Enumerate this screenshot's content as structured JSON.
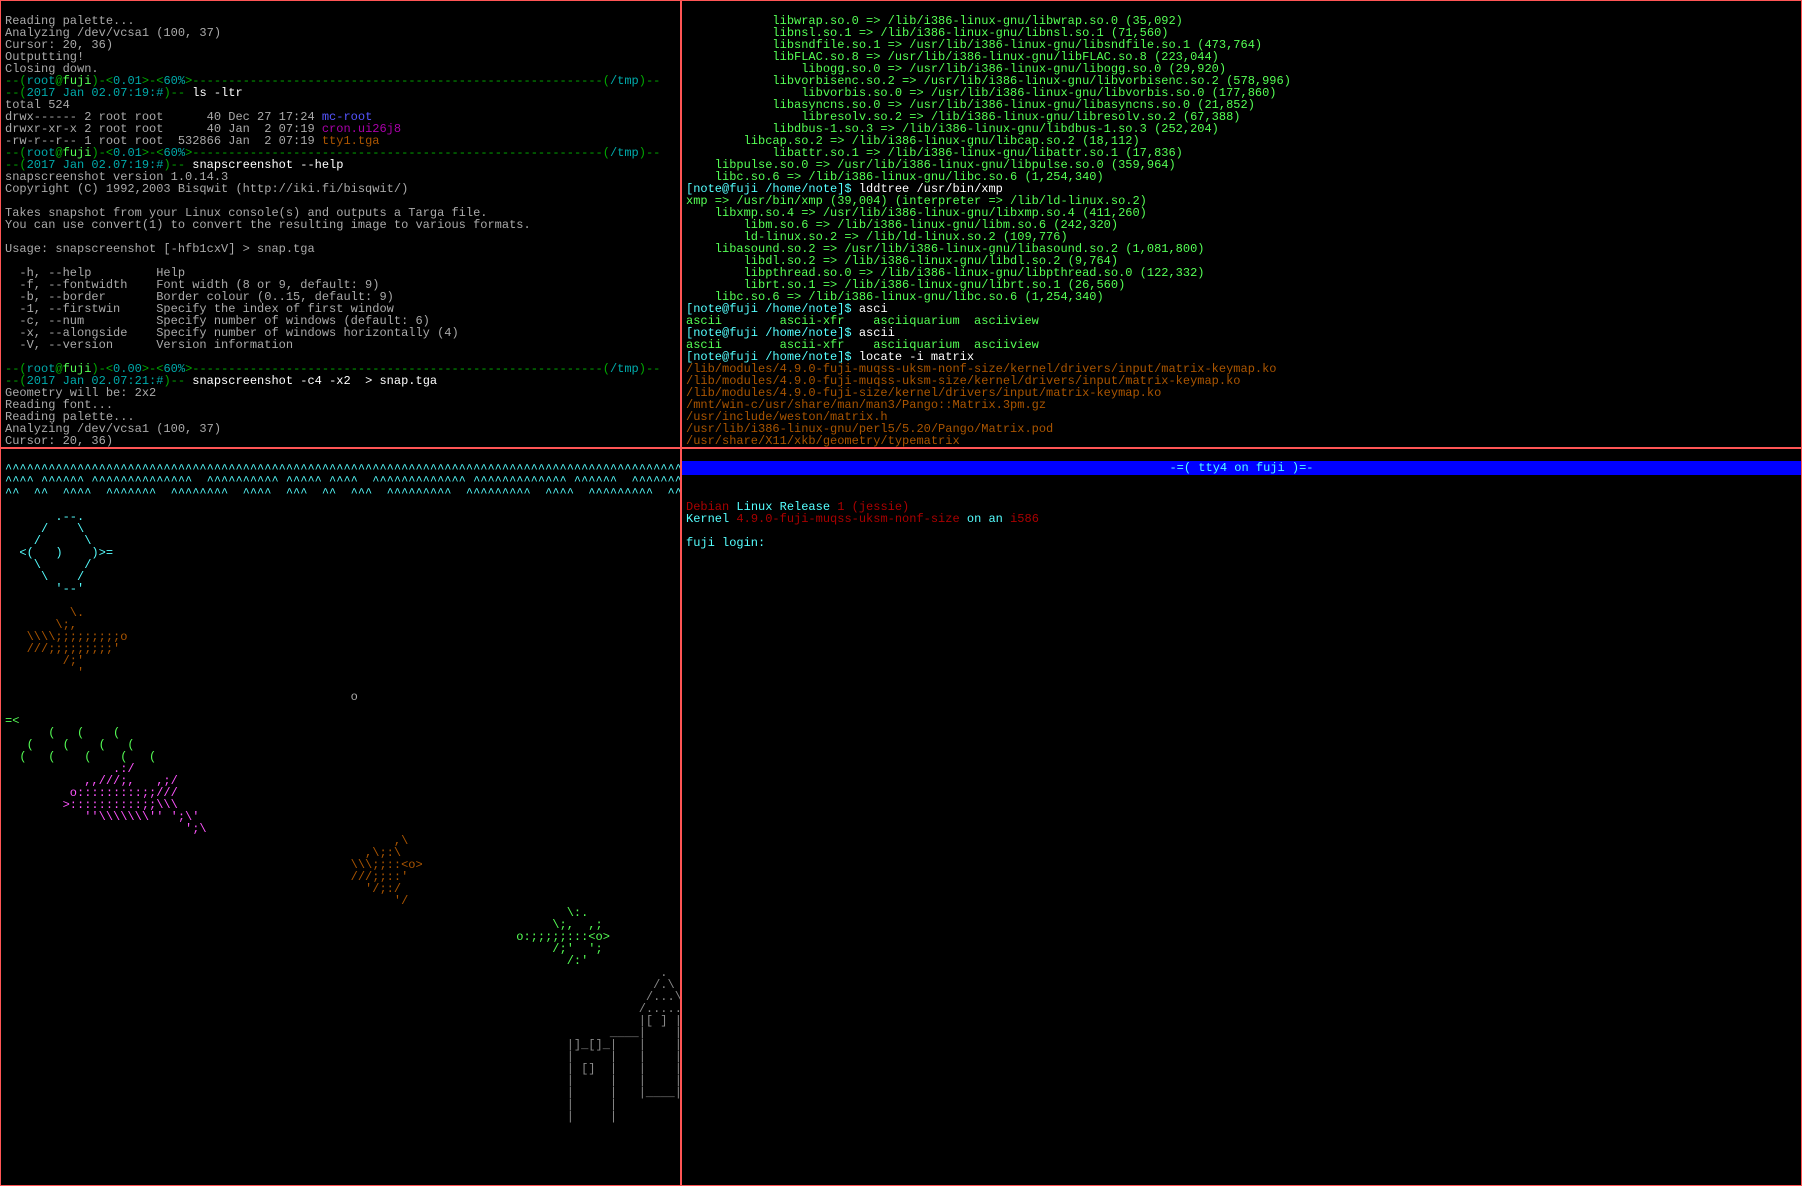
{
  "pane_tl": {
    "preamble": [
      "Reading palette...",
      "Analyzing /dev/vcsa1 (100, 37)",
      "Cursor: 20, 36)",
      "Outputting!",
      "Closing down."
    ],
    "prompt1": {
      "user": "root",
      "at": "@",
      "host": "fuji",
      "load": "0.01",
      "pct": "60%",
      "cwd": "/tmp"
    },
    "time1": "2017 Jan 02.07:19:#",
    "cmd1": "ls -ltr",
    "ls_total": "total 524",
    "ls_rows": [
      {
        "perm": "drwx------ 2 root root      40 Dec 27 17:24 ",
        "name": "mc-root",
        "cls": "c-blue"
      },
      {
        "perm": "drwxr-xr-x 2 root root      40 Jan  2 07:19 ",
        "name": "cron.ui26j8",
        "cls": "c-mag"
      },
      {
        "perm": "-rw-r--r-- 1 root root  532866 Jan  2 07:19 ",
        "name": "tty1.tga",
        "cls": "c-dyellow"
      }
    ],
    "prompt2_load": "0.01",
    "time2": "2017 Jan 02.07:19:#",
    "cmd2": "snapscreenshot --help",
    "help": [
      "snapscreenshot version 1.0.14.3",
      "Copyright (C) 1992,2003 Bisqwit (http://iki.fi/bisqwit/)",
      "",
      "Takes snapshot from your Linux console(s) and outputs a Targa file.",
      "You can use convert(1) to convert the resulting image to various formats.",
      "",
      "Usage: snapscreenshot [-hfb1cxV] > snap.tga",
      "",
      "  -h, --help         Help",
      "  -f, --fontwidth    Font width (8 or 9, default: 9)",
      "  -b, --border       Border colour (0..15, default: 9)",
      "  -1, --firstwin     Specify the index of first window",
      "  -c, --num          Specify number of windows (default: 6)",
      "  -x, --alongside    Specify number of windows horizontally (4)",
      "  -V, --version      Version information",
      ""
    ],
    "prompt3_load": "0.00",
    "time3": "2017 Jan 02.07:21:#",
    "cmd3": "snapscreenshot -c4 -x2  > snap.tga",
    "tail": [
      "Geometry will be: 2x2",
      "Reading font...",
      "Reading palette...",
      "Analyzing /dev/vcsa1 (100, 37)",
      "Cursor: 20, 36)"
    ]
  },
  "pane_tr": {
    "libs": [
      "            libwrap.so.0 => /lib/i386-linux-gnu/libwrap.so.0 (35,092)",
      "            libnsl.so.1 => /lib/i386-linux-gnu/libnsl.so.1 (71,560)",
      "            libsndfile.so.1 => /usr/lib/i386-linux-gnu/libsndfile.so.1 (473,764)",
      "            libFLAC.so.8 => /usr/lib/i386-linux-gnu/libFLAC.so.8 (223,044)",
      "                libogg.so.0 => /usr/lib/i386-linux-gnu/libogg.so.0 (29,920)",
      "            libvorbisenc.so.2 => /usr/lib/i386-linux-gnu/libvorbisenc.so.2 (578,996)",
      "                libvorbis.so.0 => /usr/lib/i386-linux-gnu/libvorbis.so.0 (177,860)",
      "            libasyncns.so.0 => /usr/lib/i386-linux-gnu/libasyncns.so.0 (21,852)",
      "                libresolv.so.2 => /lib/i386-linux-gnu/libresolv.so.2 (67,388)",
      "            libdbus-1.so.3 => /lib/i386-linux-gnu/libdbus-1.so.3 (252,204)",
      "        libcap.so.2 => /lib/i386-linux-gnu/libcap.so.2 (18,112)",
      "            libattr.so.1 => /lib/i386-linux-gnu/libattr.so.1 (17,836)",
      "    libpulse.so.0 => /usr/lib/i386-linux-gnu/libpulse.so.0 (359,964)",
      "    libc.so.6 => /lib/i386-linux-gnu/libc.so.6 (1,254,340)"
    ],
    "prompt_note": "[note@fuji /home/note]$",
    "cmd_lddtree": "lddtree /usr/bin/xmp",
    "xmp_tree": [
      "xmp => /usr/bin/xmp (39,004) (interpreter => /lib/ld-linux.so.2)",
      "    libxmp.so.4 => /usr/lib/i386-linux-gnu/libxmp.so.4 (411,260)",
      "        libm.so.6 => /lib/i386-linux-gnu/libm.so.6 (242,320)",
      "        ld-linux.so.2 => /lib/ld-linux.so.2 (109,776)",
      "    libasound.so.2 => /usr/lib/i386-linux-gnu/libasound.so.2 (1,081,800)",
      "        libdl.so.2 => /lib/i386-linux-gnu/libdl.so.2 (9,764)",
      "        libpthread.so.0 => /lib/i386-linux-gnu/libpthread.so.0 (122,332)",
      "        librt.so.1 => /lib/i386-linux-gnu/librt.so.1 (26,560)",
      "    libc.so.6 => /lib/i386-linux-gnu/libc.so.6 (1,254,340)"
    ],
    "cmd_asci": "asci",
    "asci_comp": "ascii        ascii-xfr    asciiquarium  asciiview",
    "cmd_ascii": "ascii",
    "ascii_comp": "ascii        ascii-xfr    asciiquarium  asciiview",
    "cmd_locate": "locate -i matrix",
    "locate_out": [
      "/lib/modules/4.9.0-fuji-muqss-uksm-nonf-size/kernel/drivers/input/matrix-keymap.ko",
      "/lib/modules/4.9.0-fuji-muqss-uksm-size/kernel/drivers/input/matrix-keymap.ko",
      "/lib/modules/4.9.0-fuji-size/kernel/drivers/input/matrix-keymap.ko",
      "/mnt/win-c/usr/share/man/man3/Pango::Matrix.3pm.gz",
      "/usr/include/weston/matrix.h",
      "/usr/lib/i386-linux-gnu/perl5/5.20/Pango/Matrix.pod",
      "/usr/share/X11/xkb/geometry/typematrix"
    ]
  },
  "pane_bl": {
    "waves": [
      "^^^^^^^^^^^^^^^^^^^^^^^^^^^^^^^^^^^^^^^^^^^^^^^^^^^^^^^^^^^^^^^^^^^^^^^^^^^^^^^^^^^^^^^^^^^^^^^^^^^^^^^^^^^^^^^^^^^^^^^^^^^^^^^^^^^^^^^^^^^^",
      "^^^^ ^^^^^^ ^^^^^^^^^^^^^^  ^^^^^^^^^^ ^^^^^ ^^^^  ^^^^^^^^^^^^^ ^^^^^^^^^^^^^ ^^^^^^  ^^^^^^^^^^^ ^^^^^^^^^^^^^  ^^^^^^^^^^^^^  ^^^^^^^^^^^",
      "^^  ^^  ^^^^  ^^^^^^^  ^^^^^^^^  ^^^^  ^^^  ^^  ^^^  ^^^^^^^^^  ^^^^^^^^^  ^^^^  ^^^^^^^^^  ^^^^^^^^^  ^^^^^^^^^  ^^^^^^^^^  ^^^^^^^^^  ^^^^"
    ],
    "jelly": "       .--.\n     /    \\\n    /      \\\n  <(   )    )>=\n    \\      /\n     \\    /\n       '--'",
    "fish_small": "         \\.\n       \\;,\n   \\\\\\\\;;;;;;;;;o\n   ///;;;;;;;;;'\n        /;'\n          '",
    "bubble": "                                                o",
    "whale": "=<\n      (   (    (\n   (    (    (   (\n  (   (    (    (   (",
    "fish3": "               .:/\n           ,,///;,   ,;/\n         o:::::::::;;///\n        >::::::::::;;\\\\\\\n           ''\\\\\\\\\\\\\\'' ';\\'\n                         ';\\",
    "fish4": "                                                      ,\\\n                                                  ,\\;:\\\n                                                \\\\\\;;::<o>\n                                                ///;;::' \n                                                  '/;:/\n                                                      '/",
    "fish5": "                                                                              \\:.\n                                                                            \\;,  ,;\n                                                                       o:;;;;;:::<o>\n                                                                            /;'  ';\n                                                                              /:'",
    "castle": "                                                                                           .\n                                                                                          /.\\\n                                                                                         /...\\\n                                                                                        /.....\\\n                                                                                        |[ ] |\n                                                                                    ____|    |____\n                                                                              |]_[]_|   |    |   |_[]_[|\n                                                                              |     |   |    |   |     |\n                                                                              | []  |   |    |   |  [] |\n                                                                              |     |   |    |   |     |\n                                                                              |     |   |____|   |     |\n                                                                              |     |            |     |\n                                                                              |     |            |     |"
  },
  "pane_br": {
    "bar": "-=( tty4 on fuji )=-",
    "line1_a": "Debian ",
    "line1_b": "Linux Release ",
    "line1_c": "1 (jessie)",
    "line2_a": "Kernel ",
    "line2_b": "4.9.0-fuji-muqss-uksm-nonf-size",
    "line2_c": " on an ",
    "line2_d": "i586",
    "login": "fuji login:"
  }
}
